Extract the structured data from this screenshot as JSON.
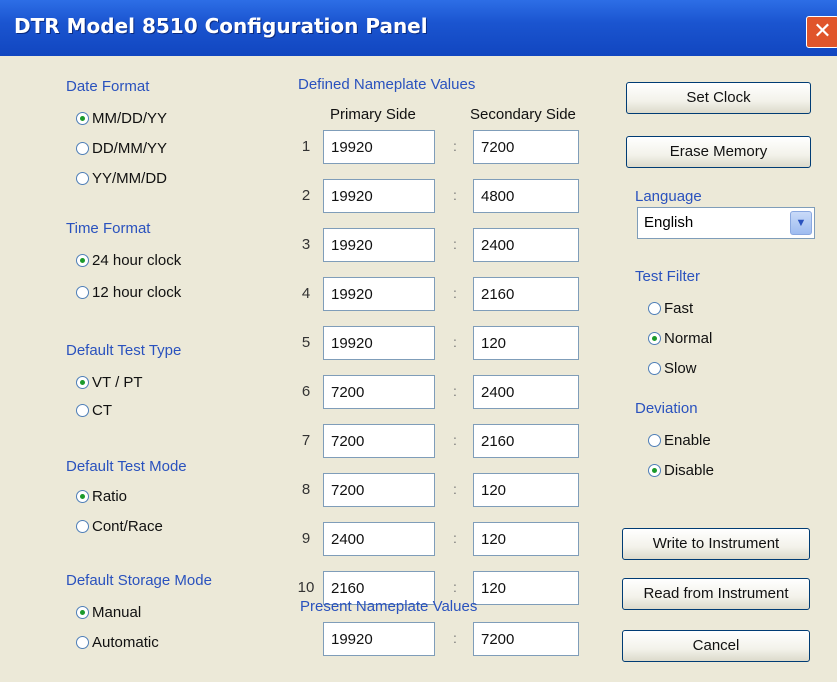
{
  "window": {
    "title": "DTR Model 8510 Configuration Panel",
    "close_glyph": "✕"
  },
  "date_format": {
    "label": "Date Format",
    "options": [
      "MM/DD/YY",
      "DD/MM/YY",
      "YY/MM/DD"
    ],
    "selected": 0
  },
  "time_format": {
    "label": "Time Format",
    "options": [
      "24 hour clock",
      "12 hour clock"
    ],
    "selected": 0
  },
  "default_test_type": {
    "label": "Default Test Type",
    "options": [
      "VT / PT",
      "CT"
    ],
    "selected": 0
  },
  "default_test_mode": {
    "label": "Default Test Mode",
    "options": [
      "Ratio",
      "Cont/Race"
    ],
    "selected": 0
  },
  "default_storage_mode": {
    "label": "Default Storage Mode",
    "options": [
      "Manual",
      "Automatic"
    ],
    "selected": 0
  },
  "nameplate": {
    "label": "Defined Nameplate Values",
    "primary_header": "Primary Side",
    "secondary_header": "Secondary Side",
    "rows": [
      {
        "num": "1",
        "primary": "19920",
        "secondary": "7200"
      },
      {
        "num": "2",
        "primary": "19920",
        "secondary": "4800"
      },
      {
        "num": "3",
        "primary": "19920",
        "secondary": "2400"
      },
      {
        "num": "4",
        "primary": "19920",
        "secondary": "2160"
      },
      {
        "num": "5",
        "primary": "19920",
        "secondary": "120"
      },
      {
        "num": "6",
        "primary": "7200",
        "secondary": "2400"
      },
      {
        "num": "7",
        "primary": "7200",
        "secondary": "2160"
      },
      {
        "num": "8",
        "primary": "7200",
        "secondary": "120"
      },
      {
        "num": "9",
        "primary": "2400",
        "secondary": "120"
      },
      {
        "num": "10",
        "primary": "2160",
        "secondary": "120"
      }
    ]
  },
  "present": {
    "label": "Present Nameplate Values",
    "primary": "19920",
    "secondary": "7200"
  },
  "buttons": {
    "set_clock": "Set Clock",
    "erase_memory": "Erase Memory",
    "write": "Write to Instrument",
    "read": "Read from Instrument",
    "cancel": "Cancel"
  },
  "language": {
    "label": "Language",
    "value": "English"
  },
  "test_filter": {
    "label": "Test Filter",
    "options": [
      "Fast",
      "Normal",
      "Slow"
    ],
    "selected": 1
  },
  "deviation": {
    "label": "Deviation",
    "options": [
      "Enable",
      "Disable"
    ],
    "selected": 1
  }
}
